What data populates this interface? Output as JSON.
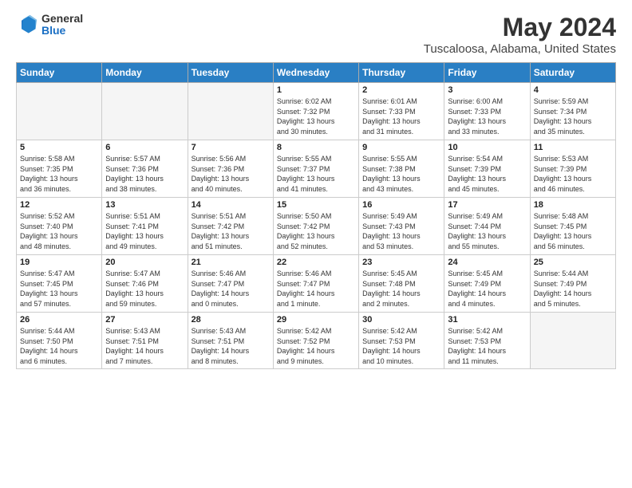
{
  "header": {
    "logo_general": "General",
    "logo_blue": "Blue",
    "title": "May 2024",
    "subtitle": "Tuscaloosa, Alabama, United States"
  },
  "weekdays": [
    "Sunday",
    "Monday",
    "Tuesday",
    "Wednesday",
    "Thursday",
    "Friday",
    "Saturday"
  ],
  "weeks": [
    [
      {
        "day": "",
        "info": ""
      },
      {
        "day": "",
        "info": ""
      },
      {
        "day": "",
        "info": ""
      },
      {
        "day": "1",
        "info": "Sunrise: 6:02 AM\nSunset: 7:32 PM\nDaylight: 13 hours\nand 30 minutes."
      },
      {
        "day": "2",
        "info": "Sunrise: 6:01 AM\nSunset: 7:33 PM\nDaylight: 13 hours\nand 31 minutes."
      },
      {
        "day": "3",
        "info": "Sunrise: 6:00 AM\nSunset: 7:33 PM\nDaylight: 13 hours\nand 33 minutes."
      },
      {
        "day": "4",
        "info": "Sunrise: 5:59 AM\nSunset: 7:34 PM\nDaylight: 13 hours\nand 35 minutes."
      }
    ],
    [
      {
        "day": "5",
        "info": "Sunrise: 5:58 AM\nSunset: 7:35 PM\nDaylight: 13 hours\nand 36 minutes."
      },
      {
        "day": "6",
        "info": "Sunrise: 5:57 AM\nSunset: 7:36 PM\nDaylight: 13 hours\nand 38 minutes."
      },
      {
        "day": "7",
        "info": "Sunrise: 5:56 AM\nSunset: 7:36 PM\nDaylight: 13 hours\nand 40 minutes."
      },
      {
        "day": "8",
        "info": "Sunrise: 5:55 AM\nSunset: 7:37 PM\nDaylight: 13 hours\nand 41 minutes."
      },
      {
        "day": "9",
        "info": "Sunrise: 5:55 AM\nSunset: 7:38 PM\nDaylight: 13 hours\nand 43 minutes."
      },
      {
        "day": "10",
        "info": "Sunrise: 5:54 AM\nSunset: 7:39 PM\nDaylight: 13 hours\nand 45 minutes."
      },
      {
        "day": "11",
        "info": "Sunrise: 5:53 AM\nSunset: 7:39 PM\nDaylight: 13 hours\nand 46 minutes."
      }
    ],
    [
      {
        "day": "12",
        "info": "Sunrise: 5:52 AM\nSunset: 7:40 PM\nDaylight: 13 hours\nand 48 minutes."
      },
      {
        "day": "13",
        "info": "Sunrise: 5:51 AM\nSunset: 7:41 PM\nDaylight: 13 hours\nand 49 minutes."
      },
      {
        "day": "14",
        "info": "Sunrise: 5:51 AM\nSunset: 7:42 PM\nDaylight: 13 hours\nand 51 minutes."
      },
      {
        "day": "15",
        "info": "Sunrise: 5:50 AM\nSunset: 7:42 PM\nDaylight: 13 hours\nand 52 minutes."
      },
      {
        "day": "16",
        "info": "Sunrise: 5:49 AM\nSunset: 7:43 PM\nDaylight: 13 hours\nand 53 minutes."
      },
      {
        "day": "17",
        "info": "Sunrise: 5:49 AM\nSunset: 7:44 PM\nDaylight: 13 hours\nand 55 minutes."
      },
      {
        "day": "18",
        "info": "Sunrise: 5:48 AM\nSunset: 7:45 PM\nDaylight: 13 hours\nand 56 minutes."
      }
    ],
    [
      {
        "day": "19",
        "info": "Sunrise: 5:47 AM\nSunset: 7:45 PM\nDaylight: 13 hours\nand 57 minutes."
      },
      {
        "day": "20",
        "info": "Sunrise: 5:47 AM\nSunset: 7:46 PM\nDaylight: 13 hours\nand 59 minutes."
      },
      {
        "day": "21",
        "info": "Sunrise: 5:46 AM\nSunset: 7:47 PM\nDaylight: 14 hours\nand 0 minutes."
      },
      {
        "day": "22",
        "info": "Sunrise: 5:46 AM\nSunset: 7:47 PM\nDaylight: 14 hours\nand 1 minute."
      },
      {
        "day": "23",
        "info": "Sunrise: 5:45 AM\nSunset: 7:48 PM\nDaylight: 14 hours\nand 2 minutes."
      },
      {
        "day": "24",
        "info": "Sunrise: 5:45 AM\nSunset: 7:49 PM\nDaylight: 14 hours\nand 4 minutes."
      },
      {
        "day": "25",
        "info": "Sunrise: 5:44 AM\nSunset: 7:49 PM\nDaylight: 14 hours\nand 5 minutes."
      }
    ],
    [
      {
        "day": "26",
        "info": "Sunrise: 5:44 AM\nSunset: 7:50 PM\nDaylight: 14 hours\nand 6 minutes."
      },
      {
        "day": "27",
        "info": "Sunrise: 5:43 AM\nSunset: 7:51 PM\nDaylight: 14 hours\nand 7 minutes."
      },
      {
        "day": "28",
        "info": "Sunrise: 5:43 AM\nSunset: 7:51 PM\nDaylight: 14 hours\nand 8 minutes."
      },
      {
        "day": "29",
        "info": "Sunrise: 5:42 AM\nSunset: 7:52 PM\nDaylight: 14 hours\nand 9 minutes."
      },
      {
        "day": "30",
        "info": "Sunrise: 5:42 AM\nSunset: 7:53 PM\nDaylight: 14 hours\nand 10 minutes."
      },
      {
        "day": "31",
        "info": "Sunrise: 5:42 AM\nSunset: 7:53 PM\nDaylight: 14 hours\nand 11 minutes."
      },
      {
        "day": "",
        "info": ""
      }
    ]
  ]
}
